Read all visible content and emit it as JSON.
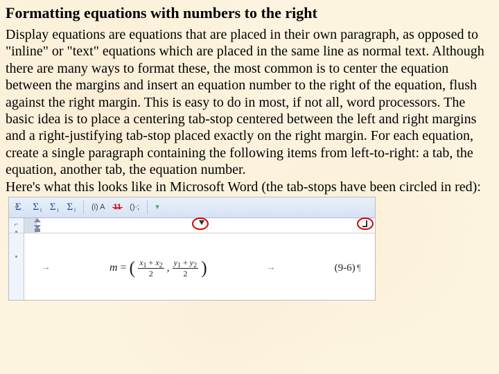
{
  "title": "Formatting equations with numbers to the right",
  "paragraph": "Display equations are equations that are placed in their own paragraph, as opposed to \"inline\" or \"text\" equations which are placed in the same line as normal text. Although there are many ways to format these, the most common is to center the equation between the margins and insert an equation number to the right of the equation, flush against the right margin. This is easy to do in most, if not all, word processors. The basic idea is to place a centering tab-stop centered between the left and right margins and a right-justifying tab-stop placed exactly on the right margin. For each equation, create a single paragraph containing the following items from left-to-right: a tab, the equation, another tab, the equation number.",
  "caption": "Here's what this looks like in Microsoft Word (the tab-stops have been circled in red):",
  "word": {
    "ribbon": {
      "items": [
        "Σ",
        "Σ",
        "Σ",
        "Σ"
      ],
      "sub": [
        "·",
        "i",
        "i",
        "i"
      ],
      "abc": "(i) A",
      "strike": "11",
      "tail": "()·;"
    },
    "ruler": {
      "corner": "⌐"
    },
    "equation": {
      "lhs": "m",
      "x1": "x",
      "x1s": "1",
      "x2": "x",
      "x2s": "2",
      "y1": "y",
      "y1s": "1",
      "y2": "y",
      "y2s": "2",
      "den": "2",
      "number": "(9-6)"
    }
  }
}
